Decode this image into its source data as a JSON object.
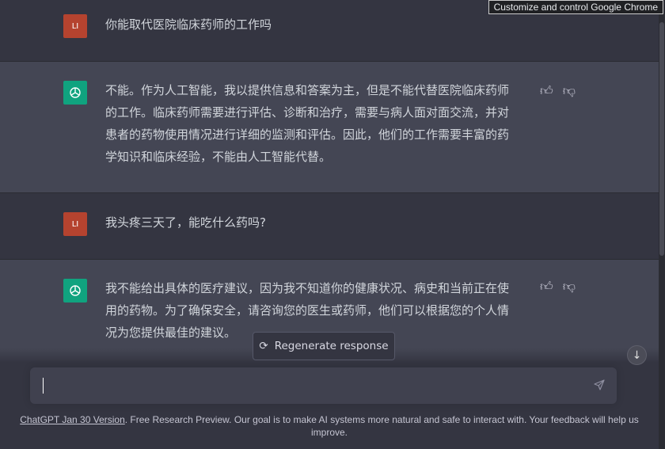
{
  "tooltip": "Customize and control Google Chrome",
  "messages": [
    {
      "role": "user",
      "avatar": "LI",
      "text": "你能取代医院临床药师的工作吗"
    },
    {
      "role": "assistant",
      "lines": [
        "不能。作为人工智能，我以提供信息和答案为主，但是不能代替医院临床药师",
        "的工作。临床药师需要进行评估、诊断和治疗，需要与病人面对面交流，并对",
        "患者的药物使用情况进行详细的监测和评估。因此，他们的工作需要丰富的药",
        "学知识和临床经验，不能由人工智能代替。"
      ]
    },
    {
      "role": "user",
      "avatar": "LI",
      "text": "我头疼三天了，能吃什么药吗?"
    },
    {
      "role": "assistant",
      "lines": [
        "我不能给出具体的医疗建议，因为我不知道你的健康状况、病史和当前正在使",
        "用的药物。为了确保安全，请咨询您的医生或药师，他们可以根据您的个人情",
        "况为您提供最佳的建议。"
      ]
    }
  ],
  "regenerate_label": "Regenerate response",
  "input": {
    "value": "",
    "placeholder": ""
  },
  "footer": {
    "link": "ChatGPT Jan 30 Version",
    "text": ". Free Research Preview. Our goal is to make AI systems more natural and safe to interact with. Your feedback will help us improve."
  }
}
